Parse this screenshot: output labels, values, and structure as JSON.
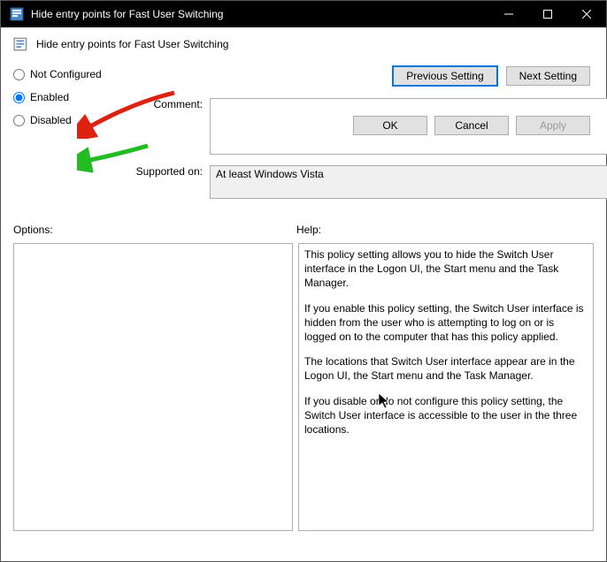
{
  "titlebar": {
    "title": "Hide entry points for Fast User Switching"
  },
  "header": {
    "title": "Hide entry points for Fast User Switching"
  },
  "nav": {
    "prev": "Previous Setting",
    "next": "Next Setting"
  },
  "radios": {
    "not_configured": "Not Configured",
    "enabled": "Enabled",
    "disabled": "Disabled",
    "selected": "enabled"
  },
  "labels": {
    "comment": "Comment:",
    "supported": "Supported on:",
    "options": "Options:",
    "help": "Help:"
  },
  "fields": {
    "comment": "",
    "supported": "At least Windows Vista"
  },
  "help": {
    "p1": "This policy setting allows you to hide the Switch User interface in the Logon UI, the Start menu and the Task Manager.",
    "p2": "If you enable this policy setting, the Switch User interface is hidden from the user who is attempting to log on or is logged on to the computer that has this policy applied.",
    "p3": "The locations that Switch User interface appear are in the Logon UI, the Start menu and the Task Manager.",
    "p4": "If you disable or do not configure this policy setting, the Switch User interface is accessible to the user in the three locations."
  },
  "footer": {
    "ok": "OK",
    "cancel": "Cancel",
    "apply": "Apply"
  }
}
